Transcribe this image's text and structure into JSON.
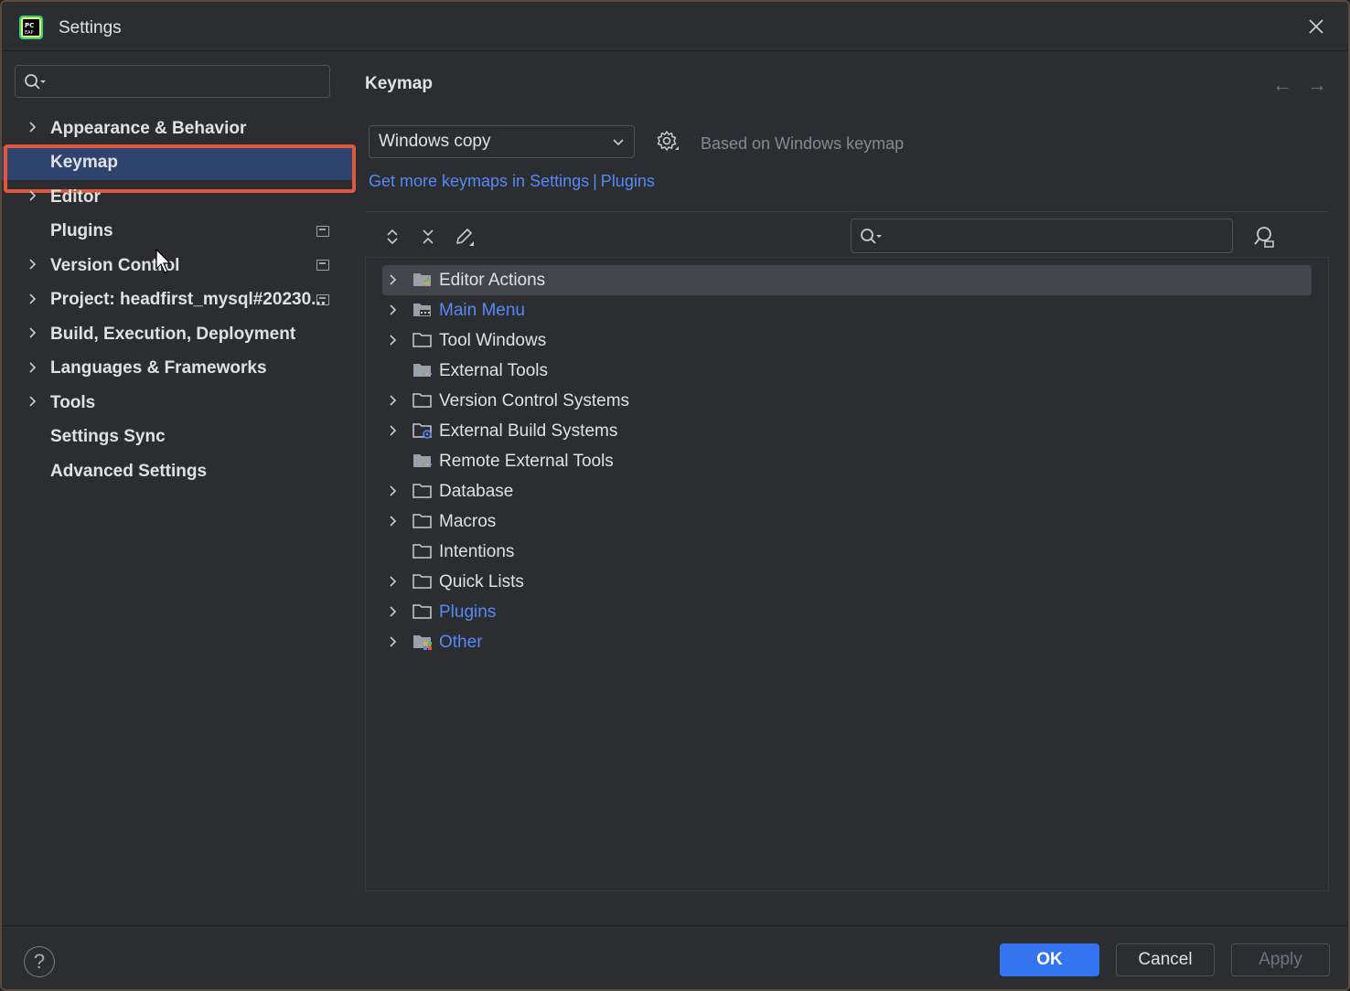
{
  "window": {
    "title": "Settings"
  },
  "sidebar": {
    "search_placeholder": "",
    "items": [
      {
        "label": "Appearance & Behavior",
        "expandable": true
      },
      {
        "label": "Keymap",
        "selected": true
      },
      {
        "label": "Editor",
        "expandable": true
      },
      {
        "label": "Plugins",
        "badge": true
      },
      {
        "label": "Version Control",
        "expandable": true,
        "badge": true
      },
      {
        "label": "Project: headfirst_mysql#20230...",
        "expandable": true,
        "badge": true
      },
      {
        "label": "Build, Execution, Deployment",
        "expandable": true
      },
      {
        "label": "Languages & Frameworks",
        "expandable": true
      },
      {
        "label": "Tools",
        "expandable": true
      },
      {
        "label": "Settings Sync"
      },
      {
        "label": "Advanced Settings"
      }
    ]
  },
  "main": {
    "title": "Keymap",
    "keymap_select": "Windows copy",
    "based_on": "Based on Windows keymap",
    "link_settings": "Get more keymaps in Settings",
    "link_sep": "|",
    "link_plugins": "Plugins",
    "tree_search_placeholder": "",
    "tree": [
      {
        "label": "Editor Actions",
        "expandable": true,
        "icon": "editor-actions-folder-icon",
        "highlighted": true
      },
      {
        "label": "Main Menu",
        "expandable": true,
        "icon": "menu-folder-icon",
        "blue": true
      },
      {
        "label": "Tool Windows",
        "expandable": true,
        "icon": "folder-icon"
      },
      {
        "label": "External Tools",
        "expandable": false,
        "icon": "tools-folder-icon"
      },
      {
        "label": "Version Control Systems",
        "expandable": true,
        "icon": "folder-icon"
      },
      {
        "label": "External Build Systems",
        "expandable": true,
        "icon": "build-folder-icon"
      },
      {
        "label": "Remote External Tools",
        "expandable": false,
        "icon": "tools-folder-icon"
      },
      {
        "label": "Database",
        "expandable": true,
        "icon": "folder-icon"
      },
      {
        "label": "Macros",
        "expandable": true,
        "icon": "folder-icon"
      },
      {
        "label": "Intentions",
        "expandable": false,
        "icon": "folder-icon"
      },
      {
        "label": "Quick Lists",
        "expandable": true,
        "icon": "folder-icon"
      },
      {
        "label": "Plugins",
        "expandable": true,
        "icon": "folder-icon",
        "blue": true
      },
      {
        "label": "Other",
        "expandable": true,
        "icon": "other-folder-icon",
        "blue": true
      }
    ]
  },
  "footer": {
    "help": "?",
    "ok": "OK",
    "cancel": "Cancel",
    "apply": "Apply"
  },
  "colors": {
    "background": "#2b2d30",
    "accent": "#3574f0",
    "link": "#548af7",
    "selection": "#2e436e",
    "highlight_outline": "#e0573f"
  }
}
